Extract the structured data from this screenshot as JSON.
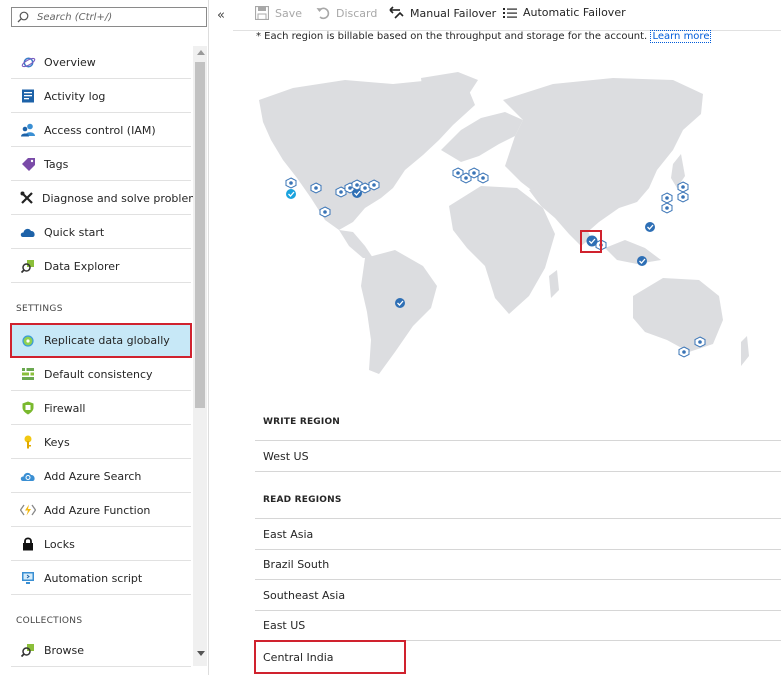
{
  "search": {
    "placeholder": "Search (Ctrl+/)"
  },
  "collapse_glyph": "«",
  "nav_top": [
    {
      "label": "Overview",
      "icon": "globe-icon"
    },
    {
      "label": "Activity log",
      "icon": "activity-log-icon"
    },
    {
      "label": "Access control (IAM)",
      "icon": "users-icon"
    },
    {
      "label": "Tags",
      "icon": "tag-icon"
    },
    {
      "label": "Diagnose and solve problems",
      "icon": "wrench-icon"
    },
    {
      "label": "Quick start",
      "icon": "cloud-icon"
    },
    {
      "label": "Data Explorer",
      "icon": "data-explorer-icon"
    }
  ],
  "settings_header": "SETTINGS",
  "nav_settings": [
    {
      "label": "Replicate data globally",
      "icon": "replicate-globe-icon",
      "selected": true
    },
    {
      "label": "Default consistency",
      "icon": "consistency-icon"
    },
    {
      "label": "Firewall",
      "icon": "firewall-icon"
    },
    {
      "label": "Keys",
      "icon": "key-icon"
    },
    {
      "label": "Add Azure Search",
      "icon": "search-cloud-icon"
    },
    {
      "label": "Add Azure Function",
      "icon": "function-icon"
    },
    {
      "label": "Locks",
      "icon": "lock-icon"
    },
    {
      "label": "Automation script",
      "icon": "automation-icon"
    }
  ],
  "collections_header": "COLLECTIONS",
  "nav_collections": [
    {
      "label": "Browse",
      "icon": "browse-icon"
    }
  ],
  "toolbar": {
    "save": "Save",
    "discard": "Discard",
    "manual_failover": "Manual Failover",
    "automatic_failover": "Automatic Failover"
  },
  "note": {
    "text": "* Each region is billable based on the throughput and storage for the account.",
    "link": "Learn more"
  },
  "write_region": {
    "header": "WRITE REGION",
    "items": [
      "West US"
    ]
  },
  "read_regions": {
    "header": "READ REGIONS",
    "items": [
      "East Asia",
      "Brazil South",
      "Southeast Asia",
      "East US",
      "Central India"
    ],
    "highlighted": "Central India"
  },
  "colors": {
    "selected_bg": "#c7e8f7",
    "highlight_border": "#d0222e",
    "region_available": "#3a74b6",
    "region_selected": "#2e6fb5",
    "write_region": "#1aa3de",
    "land": "#dcdde0"
  }
}
